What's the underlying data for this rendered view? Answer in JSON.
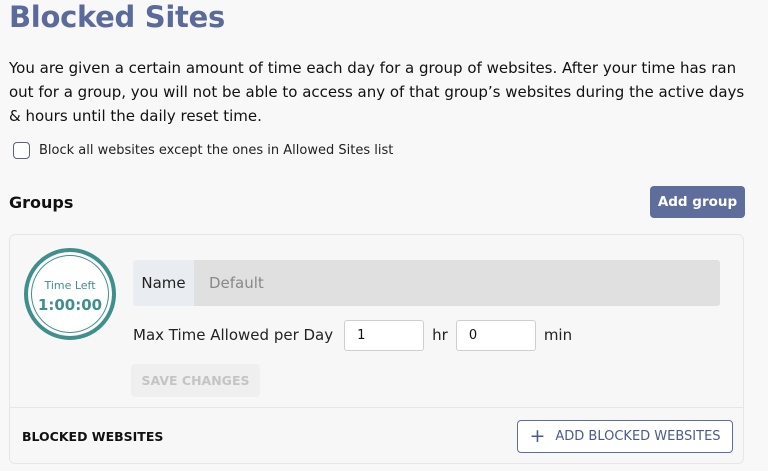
{
  "page": {
    "title": "Blocked Sites",
    "description": "You are given a certain amount of time each day for a group of websites. After your time has ran out for a group, you will not be able to access any of that group’s websites during the active days & hours until the daily reset time."
  },
  "block_all": {
    "label": "Block all websites except the ones in Allowed Sites list",
    "checked": false
  },
  "groups": {
    "heading": "Groups",
    "add_button": "Add group",
    "items": [
      {
        "timer_label": "Time Left",
        "timer_value": "1:00:00",
        "name_label": "Name",
        "name_placeholder": "Default",
        "max_time_label": "Max Time Allowed per Day",
        "hours_value": "1",
        "hours_unit": "hr",
        "minutes_value": "0",
        "minutes_unit": "min",
        "save_button": "SAVE CHANGES",
        "blocked_heading": "BLOCKED WEBSITES",
        "add_blocked_button": "ADD BLOCKED WEBSITES"
      }
    ]
  },
  "colors": {
    "accent": "#5f6d9c",
    "title": "#5a6a9a",
    "timer": "#3f8f8c"
  }
}
